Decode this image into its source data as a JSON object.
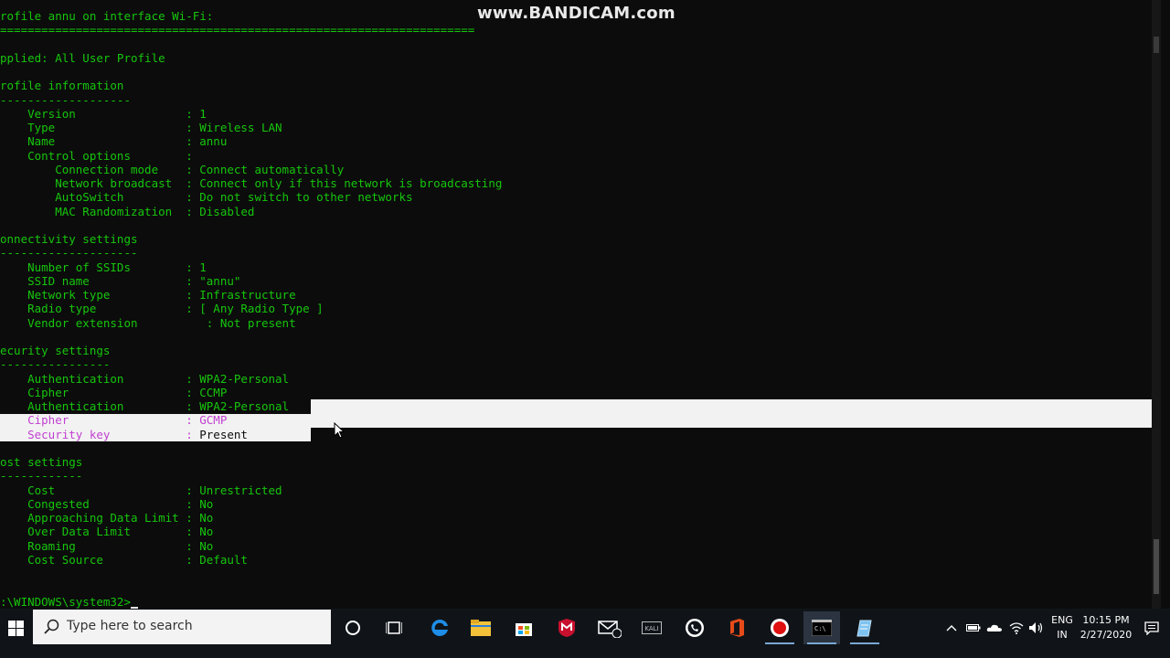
{
  "watermark": "www.BANDICAM.com",
  "console": {
    "lines": [
      "rofile annu on interface Wi-Fi:",
      "=====================================================================",
      "",
      "pplied: All User Profile",
      "",
      "rofile information",
      "-------------------",
      "    Version                : 1",
      "    Type                   : Wireless LAN",
      "    Name                   : annu",
      "    Control options        :",
      "        Connection mode    : Connect automatically",
      "        Network broadcast  : Connect only if this network is broadcasting",
      "        AutoSwitch         : Do not switch to other networks",
      "        MAC Randomization  : Disabled",
      "",
      "onnectivity settings",
      "--------------------",
      "    Number of SSIDs        : 1",
      "    SSID name              : \"annu\"",
      "    Network type           : Infrastructure",
      "    Radio type             : [ Any Radio Type ]",
      "    Vendor extension          : Not present",
      "",
      "ecurity settings",
      "----------------",
      "    Authentication         : WPA2-Personal",
      "    Cipher                 : CCMP",
      "    Authentication         : WPA2-Personal",
      "    Cipher                 : GCMP",
      "    Security key           : Present",
      "",
      "ost settings",
      "------------",
      "    Cost                   : Unrestricted",
      "    Congested              : No",
      "    Approaching Data Limit : No",
      "    Over Data Limit        : No",
      "    Roaming                : No",
      "    Cost Source            : Default",
      "",
      "",
      ":\\WINDOWS\\system32>"
    ]
  },
  "taskbar": {
    "search_placeholder": "Type here to search",
    "language": "ENG",
    "region": "IN",
    "time": "10:15 PM",
    "date": "2/27/2020",
    "icons": [
      "cortana-icon",
      "task-view-icon",
      "edge-icon",
      "file-explorer-icon",
      "store-icon",
      "mcafee-icon",
      "mail-icon",
      "kali-icon",
      "whatsapp-icon",
      "office-icon",
      "bandicam-record-icon",
      "command-prompt-icon",
      "notepad-icon"
    ]
  }
}
